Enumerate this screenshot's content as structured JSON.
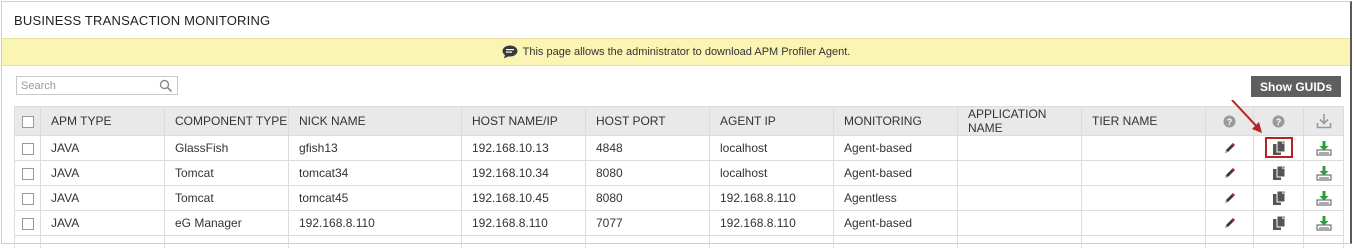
{
  "panel": {
    "title": "BUSINESS TRANSACTION MONITORING"
  },
  "info_bar": {
    "icon": "chat-bubble-icon",
    "message": "This page allows the administrator to download APM Profiler Agent."
  },
  "search": {
    "placeholder": "Search",
    "value": ""
  },
  "toolbar": {
    "show_guids_label": "Show GUIDs"
  },
  "table": {
    "columns": [
      "APM TYPE",
      "COMPONENT TYPE",
      "NICK NAME",
      "HOST NAME/IP",
      "HOST PORT",
      "AGENT IP",
      "MONITORING",
      "APPLICATION NAME",
      "TIER NAME"
    ],
    "rows": [
      [
        "JAVA",
        "GlassFish",
        "gfish13",
        "192.168.10.13",
        "4848",
        "localhost",
        "Agent-based",
        "",
        ""
      ],
      [
        "JAVA",
        "Tomcat",
        "tomcat34",
        "192.168.10.34",
        "8080",
        "localhost",
        "Agent-based",
        "",
        ""
      ],
      [
        "JAVA",
        "Tomcat",
        "tomcat45",
        "192.168.10.45",
        "8080",
        "192.168.8.110",
        "Agentless",
        "",
        ""
      ],
      [
        "JAVA",
        "eG Manager",
        "192.168.8.110",
        "192.168.8.110",
        "7077",
        "192.168.8.110",
        "Agent-based",
        "",
        ""
      ]
    ]
  },
  "colors": {
    "accent_red": "#b52424",
    "download_green": "#2e9e3a",
    "info_bg": "#fbf5b4",
    "button_bg": "#5f5f5f"
  }
}
